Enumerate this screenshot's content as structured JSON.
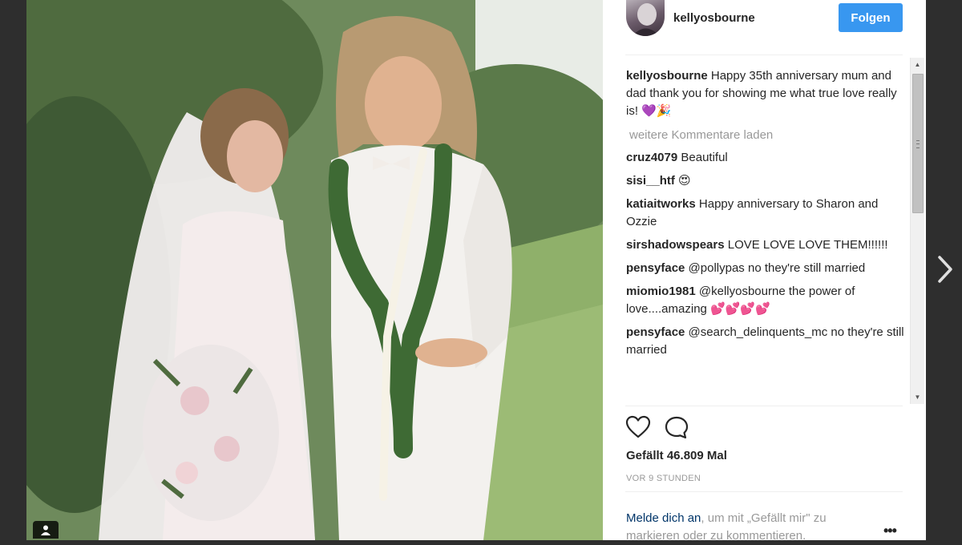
{
  "post": {
    "username": "kellyosbourne",
    "follow_label": "Folgen",
    "caption": "Happy 35th anniversary mum and dad thank you for showing me what true love really is! 💜🎉",
    "load_more_label": "weitere Kommentare laden",
    "comments": [
      {
        "user": "cruz4079",
        "text": "Beautiful"
      },
      {
        "user": "sisi__htf",
        "text": "😍"
      },
      {
        "user": "katiaitworks",
        "text": "Happy anniversary to Sharon and Ozzie"
      },
      {
        "user": "sirshadowspears",
        "text": "LOVE LOVE LOVE THEM!!!!!!"
      },
      {
        "user": "pensyface",
        "text": "@pollypas no they're still married"
      },
      {
        "user": "miomio1981",
        "text": "@kellyosbourne the power of love....amazing 💕💕💕💕"
      },
      {
        "user": "pensyface",
        "text": "@search_delinquents_mc no they're still married"
      }
    ],
    "likes_label": "Gefällt 46.809 Mal",
    "timestamp": "VOR 9 STUNDEN",
    "login_link": "Melde dich an",
    "login_rest": ", um mit „Gefällt mir\" zu markieren oder zu kommentieren."
  },
  "icons": {
    "like": "heart-icon",
    "comment": "comment-icon",
    "more": "more-options-icon",
    "next": "chevron-right-icon",
    "user_tag": "user-tag-icon"
  },
  "colors": {
    "follow_button": "#3897f0",
    "text": "#262626",
    "muted": "#999999",
    "link": "#003569",
    "backdrop": "#2e2e2e"
  }
}
